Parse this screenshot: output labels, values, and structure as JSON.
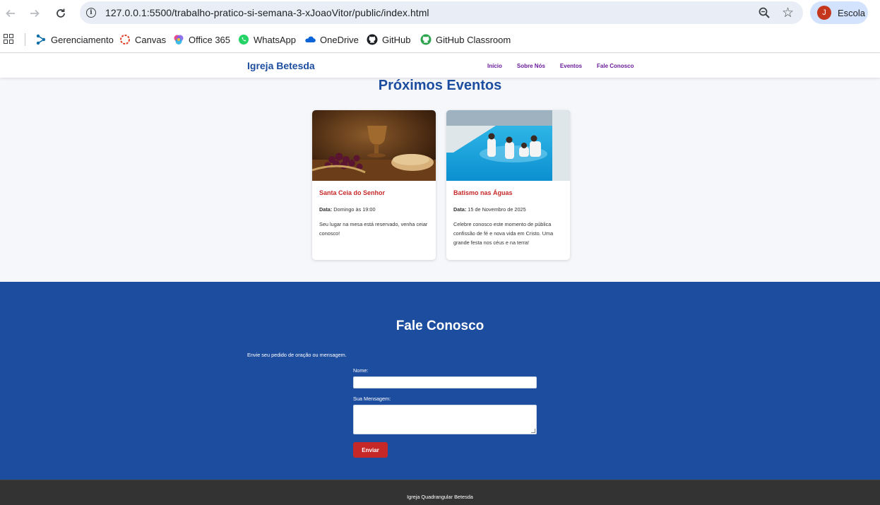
{
  "browser": {
    "url": "127.0.0.1:5500/trabalho-pratico-si-semana-3-xJoaoVitor/public/index.html",
    "profile_initial": "J",
    "profile_name": "Escola",
    "bookmarks": [
      {
        "label": "Gerenciamento",
        "icon": "gerenciamento-icon"
      },
      {
        "label": "Canvas",
        "icon": "canvas-icon"
      },
      {
        "label": "Office 365",
        "icon": "office-icon"
      },
      {
        "label": "WhatsApp",
        "icon": "whatsapp-icon"
      },
      {
        "label": "OneDrive",
        "icon": "onedrive-icon"
      },
      {
        "label": "GitHub",
        "icon": "github-icon"
      },
      {
        "label": "GitHub Classroom",
        "icon": "github-classroom-icon"
      }
    ]
  },
  "header": {
    "logo": "Igreja Betesda",
    "nav": [
      "Início",
      "Sobre Nós",
      "Eventos",
      "Fale Conosco"
    ]
  },
  "events": {
    "title": "Próximos Eventos",
    "cards": [
      {
        "title": "Santa Ceia do Senhor",
        "date_label": "Data:",
        "date_value": "Domingo às 19:00",
        "description": "Seu lugar na mesa está reservado, venha ceiar conosco!"
      },
      {
        "title": "Batismo nas Águas",
        "date_label": "Data:",
        "date_value": "15 de Novembro de 2025",
        "description": "Celebre conosco este momento de pública confissão de fé e nova vida em Cristo. Uma grande festa nos céus e na terra!"
      }
    ]
  },
  "contact": {
    "title": "Fale Conosco",
    "intro": "Envie seu pedido de oração ou mensagem.",
    "name_label": "Nome:",
    "name_value": "",
    "message_label": "Sua Mensagem:",
    "message_value": "",
    "submit_label": "Enviar"
  },
  "footer": {
    "text": "Igreja Quadrangular Betesda"
  },
  "colors": {
    "primary_blue": "#1d4d9f",
    "accent_red": "#c62828",
    "nav_purple": "#6a1b9a",
    "footer_dark": "#333333",
    "events_bg": "#f5f7fa"
  }
}
